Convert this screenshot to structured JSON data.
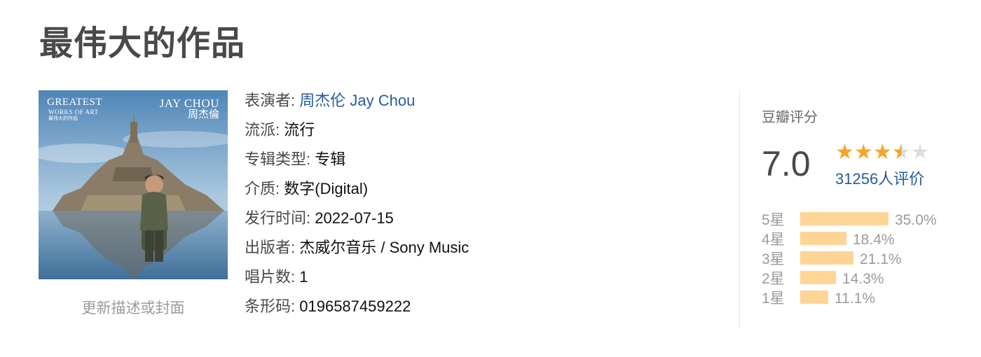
{
  "page": {
    "title": "最伟大的作品"
  },
  "cover": {
    "title_line1": "GREATEST",
    "title_line2": "WORKS OF ART",
    "title_line3": "最伟大的作品",
    "artist_en": "JAY CHOU",
    "artist_zh": "周杰倫",
    "update_link": "更新描述或封面"
  },
  "info": {
    "performer_label": "表演者:",
    "performer_value": "周杰伦 Jay Chou",
    "genre_label": "流派:",
    "genre_value": "流行",
    "album_type_label": "专辑类型:",
    "album_type_value": "专辑",
    "media_label": "介质:",
    "media_value": "数字(Digital)",
    "release_label": "发行时间:",
    "release_value": "2022-07-15",
    "publisher_label": "出版者:",
    "publisher_value": "杰威尔音乐 / Sony Music",
    "discs_label": "唱片数:",
    "discs_value": "1",
    "barcode_label": "条形码:",
    "barcode_value": "0196587459222"
  },
  "rating": {
    "title": "豆瓣评分",
    "score": "7.0",
    "stars": 3.5,
    "count": "31256人评价",
    "accent_color": "#f5a52b",
    "bar_color": "#ffd596",
    "distribution": [
      {
        "label": "5星",
        "percent": "35.0%",
        "value": 35.0
      },
      {
        "label": "4星",
        "percent": "18.4%",
        "value": 18.4
      },
      {
        "label": "3星",
        "percent": "21.1%",
        "value": 21.1
      },
      {
        "label": "2星",
        "percent": "14.3%",
        "value": 14.3
      },
      {
        "label": "1星",
        "percent": "11.1%",
        "value": 11.1
      }
    ]
  }
}
